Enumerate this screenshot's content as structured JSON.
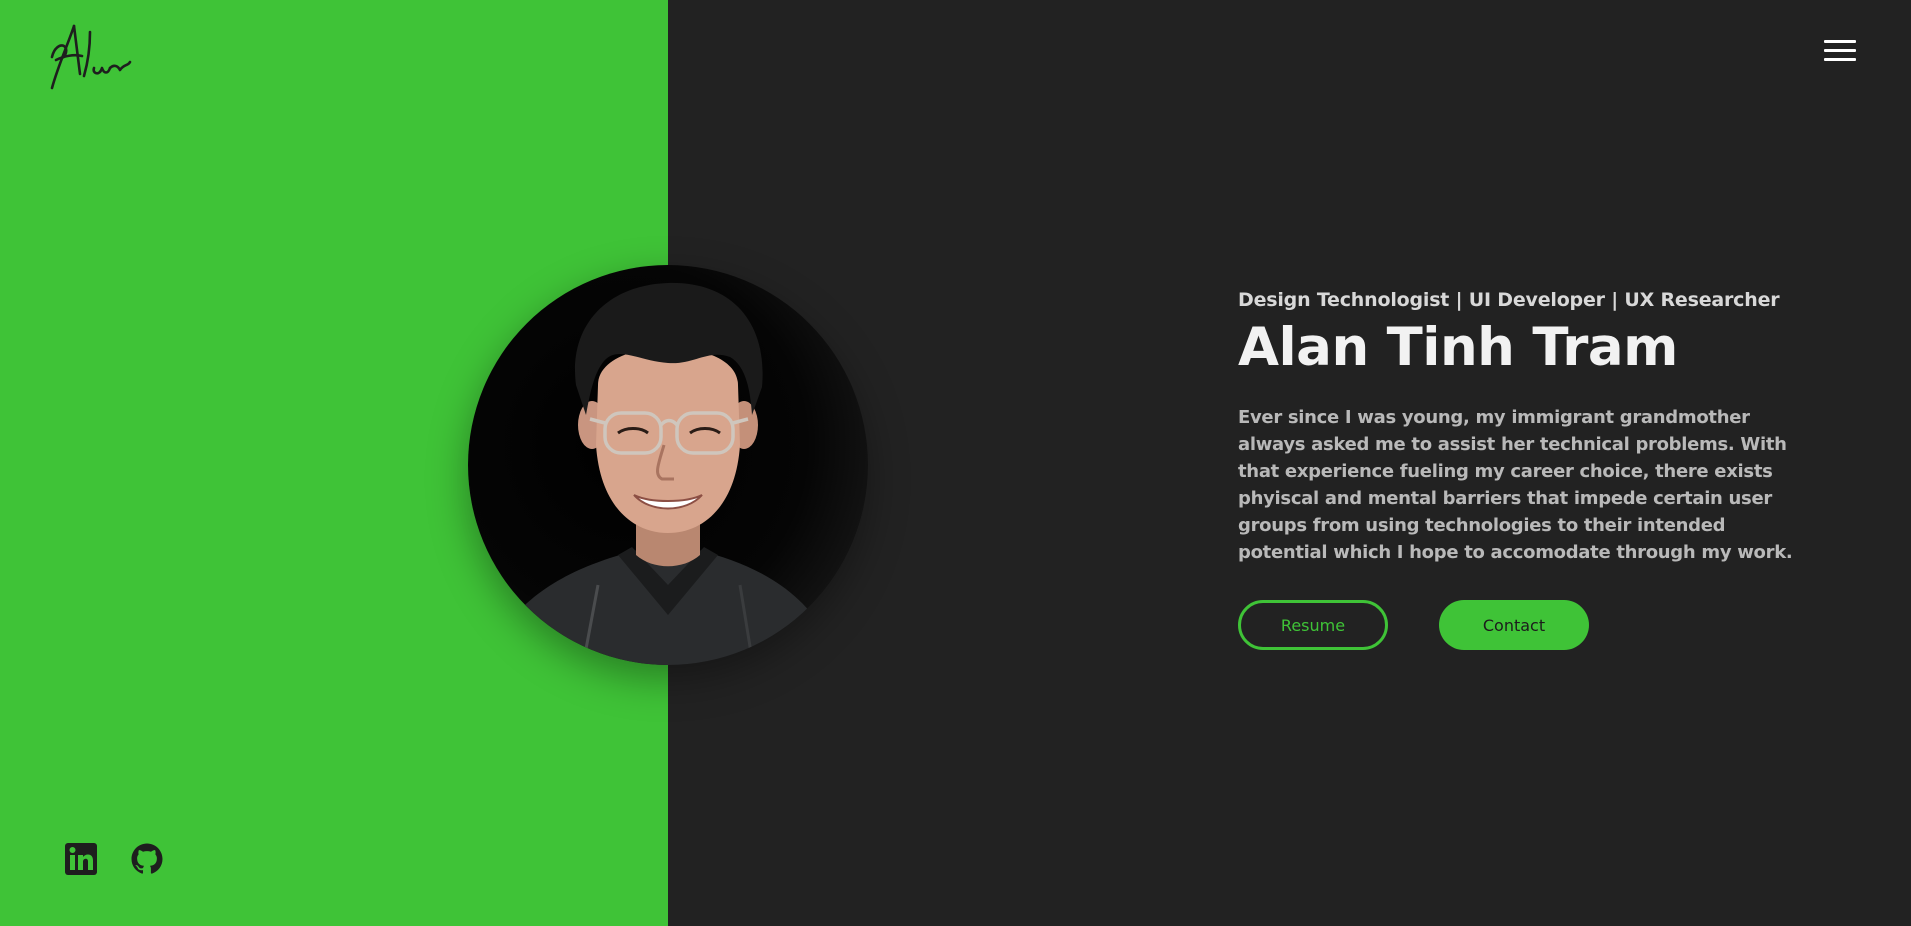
{
  "brand": {
    "logo_text": "Alan",
    "logo_icon": "signature-logo"
  },
  "nav": {
    "menu_icon": "hamburger-menu-icon"
  },
  "hero": {
    "subtitle": "Design Technologist | UI Developer | UX Researcher",
    "name": "Alan Tinh Tram",
    "bio": "Ever since I was young, my immigrant grandmother always asked me to assist her technical problems. With that experience fueling my career choice, there exists phyiscal and mental barriers that impede certain user groups from using technologies to their intended potential which I hope to accomodate through my work.",
    "buttons": {
      "resume": "Resume",
      "contact": "Contact"
    }
  },
  "social": {
    "items": [
      {
        "icon": "linkedin-icon"
      },
      {
        "icon": "github-icon"
      }
    ]
  },
  "colors": {
    "accent": "#3fc337",
    "background": "#222222",
    "text_primary": "#f2f2f2",
    "text_secondary": "#b9b9b9"
  }
}
